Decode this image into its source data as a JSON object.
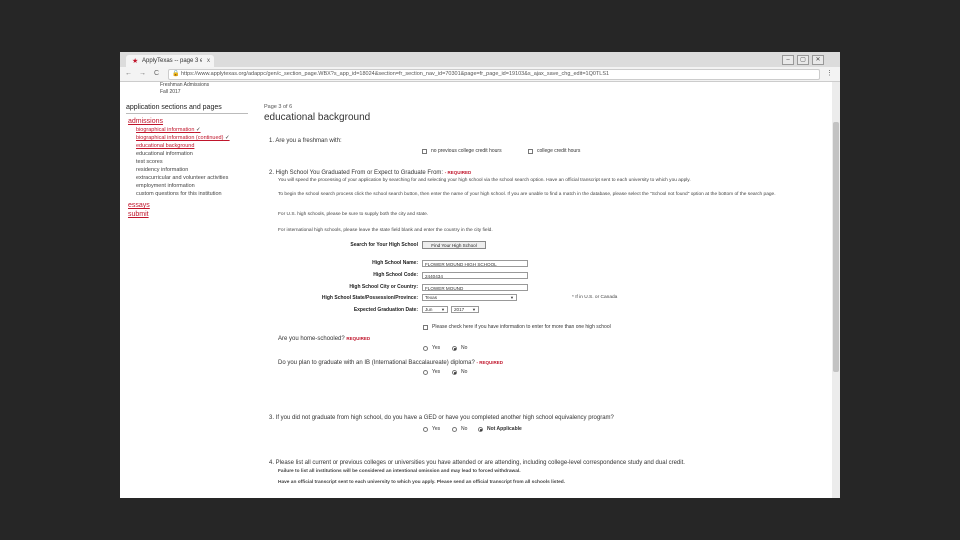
{
  "browser": {
    "tab_title": "ApplyTexas -- page 3 ed...",
    "tab_close": "x",
    "url": "https://www.applytexas.org/adappc/gen/c_section_page.WBX?s_app_id=18024&section=fr_section_nav_id=70301&page=fr_page_id=19103&s_ajax_save_chg_edit=1Q0TLS1",
    "back": "←",
    "forward": "→",
    "reload": "C",
    "menu": "⋮",
    "win_min": "–",
    "win_max": "▢",
    "win_close": "✕"
  },
  "header": {
    "top_line1": "Freshman Admissions",
    "top_line2": "Fall 2017",
    "page_label": "Page 3 of 6",
    "page_title": "educational background"
  },
  "sidebar": {
    "heading": "application sections and pages",
    "section_admissions": "admissions",
    "items": [
      {
        "label": "biographical information",
        "check": "✓"
      },
      {
        "label": "biographical information (continued)",
        "check": "✓"
      },
      {
        "label": "educational background",
        "check": ""
      },
      {
        "label": "educational information",
        "check": ""
      },
      {
        "label": "test scores",
        "check": ""
      },
      {
        "label": "residency information",
        "check": ""
      },
      {
        "label": "extracurricular and volunteer activities",
        "check": ""
      },
      {
        "label": "employment information",
        "check": ""
      },
      {
        "label": "custom questions for this institution",
        "check": ""
      }
    ],
    "essays": "essays",
    "submit": "submit"
  },
  "q1": {
    "text": "1.  Are you a freshman with:",
    "opt1": "no previous college credit hours",
    "opt2": "college credit hours"
  },
  "q2": {
    "text": "2.  High School You Graduated From or Expect to Graduate From:",
    "required": "- REQUIRED",
    "para1": "You will speed the processing of your application by searching for and selecting your high school via the school search option. Have an official transcript sent to each university to which you apply.",
    "para2": "To begin the school search process click the school search button, then enter the name of your high school. If you are unable to find a match in the database, please select the \"School not found\" option at the bottom of the search page.",
    "para3": "For U.S. high schools, please be sure to supply both the city and state.",
    "para4": "For international high schools, please leave the state field blank and enter the country in the city field.",
    "search_label": "Search for Your High School",
    "search_button": "Find Your High School",
    "name_label": "High School Name:",
    "name_value": "FLOWER MOUND HIGH SCHOOL",
    "code_label": "High School Code:",
    "code_value": "2440434",
    "city_label": "High School City or Country:",
    "city_value": "FLOWER MOUND",
    "state_label": "High School State/Possession/Province:",
    "state_value": "Texas",
    "state_note": "* If in U.S. or Canada",
    "grad_label": "Expected Graduation Date:",
    "grad_month": "Jun",
    "grad_year": "2017",
    "more_hs": "Please check here if you have information to enter for more than one high school",
    "homeschool_q": "Are you home-schooled?",
    "homeschool_req": "REQUIRED",
    "ib_q": "Do you plan to graduate with an IB (International Baccalaureate) diploma?",
    "ib_req": "- REQUIRED",
    "yes": "Yes",
    "no": "No"
  },
  "q3": {
    "text": "3.  If you did not graduate from high school, do you have a GED or have you completed another high school equivalency program?",
    "yes": "Yes",
    "no": "No",
    "na": "Not Applicable"
  },
  "q4": {
    "text": "4.  Please list all current or previous colleges or universities you have attended or are attending, including college-level correspondence study and dual credit.",
    "warn": "Failure to list all institutions will be considered an intentional omission and may lead to forced withdrawal.",
    "transcript": "Have an official transcript sent to each university to which you apply. Please send an official transcript from all schools listed."
  }
}
